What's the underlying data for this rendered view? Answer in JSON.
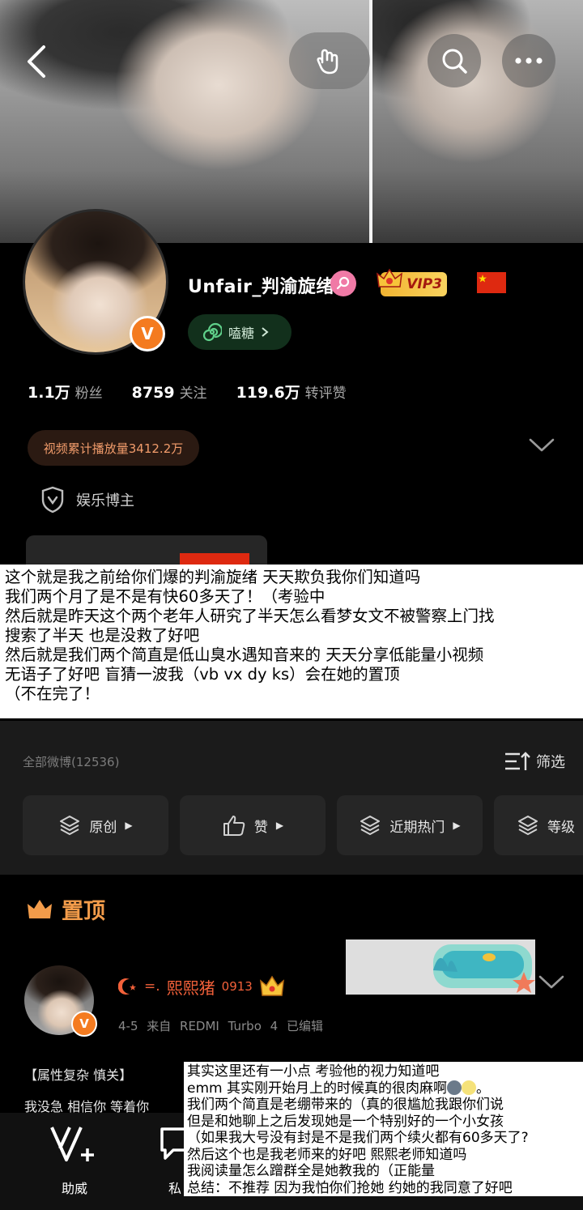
{
  "profile": {
    "username": "Unfair_判渝旋绪",
    "vip_label": "VIP3",
    "candy_label": "嗑糖",
    "stats": [
      {
        "value": "1.1万",
        "label": "粉丝"
      },
      {
        "value": "8759",
        "label": "关注"
      },
      {
        "value": "119.6万",
        "label": "转评赞"
      }
    ],
    "views_label": "视频累计播放量3412.2万",
    "category_tag": "娱乐博主",
    "avatar_badge": "V"
  },
  "note_overlay_1": {
    "lines": [
      "这个就是我之前给你们爆的判渝旋绪 天天欺负我你们知道吗",
      "我们两个月了是不是有快60多天了！（考验中",
      "然后就是昨天这个两个老年人研究了半天怎么看梦女文不被警察上门找",
      "搜索了半天 也是没救了好吧",
      "然后就是我们两个简直是低山臭水遇知音来的 天天分享低能量小视频",
      "无语子了好吧 盲猜一波我（vb vx dy ks）会在她的置顶",
      "（不在完了！"
    ]
  },
  "feed": {
    "all_posts_label": "全部微博(12536)",
    "filter_label": "筛选",
    "chips": [
      "原创",
      "赞",
      "近期热门",
      "等级"
    ]
  },
  "pinned": {
    "title": "置顶",
    "author_tag": "=.",
    "author_name": "熙熙猪",
    "author_num": "0913",
    "post_meta": "4-5  来自 REDMI Turbo 4  已编辑",
    "line1": "【属性复杂 慎关】",
    "line2": "我没急 相信你 等着你"
  },
  "bottom_bar": {
    "items": [
      {
        "label": "助威",
        "icon": "v-plus-icon"
      },
      {
        "label": "私",
        "icon": "message-icon"
      }
    ]
  },
  "note_overlay_2": {
    "lines": [
      "其实这里还有一小点 考验他的视力知道吧",
      "emm 其实刚开始月上的时候真的很肉麻啊",
      "我们两个简直是老绷带来的（真的很尴尬我跟你们说",
      "但是和她聊上之后发现她是一个特别好的一个小女孩",
      "（如果我大号没有封是不是我们两个续火都有60多天了?",
      "然后这个也是我老师来的好吧 熙熙老师知道吗",
      " 我阅读量怎么蹭群全是她教我的（正能量",
      "总结：不推荐 因为我怕你们抢她 约她的我同意了好吧"
    ]
  },
  "colors": {
    "accent_orange": "#f47b20",
    "pinned_orange": "#f39c4a",
    "author_red": "#f3613a",
    "vip_gold": "#f2b431"
  }
}
